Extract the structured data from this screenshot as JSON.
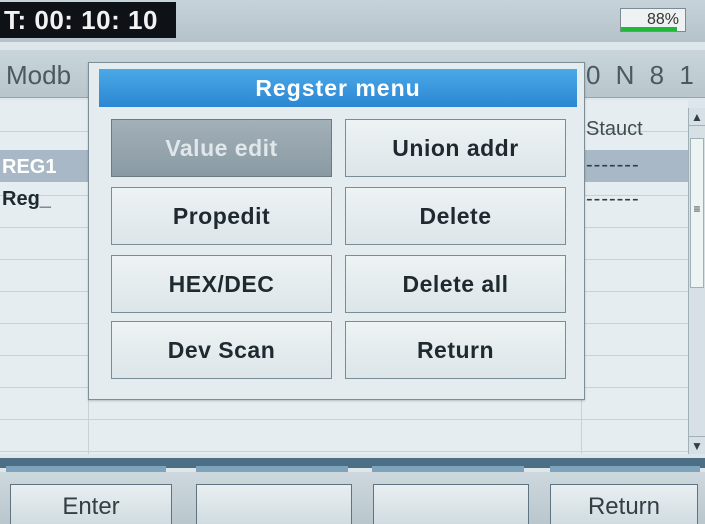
{
  "status": {
    "timer": "T: 00: 10: 10",
    "battery": "88%",
    "battery_level": 0.88
  },
  "header": {
    "title_left": "Modb",
    "title_right": "0 N 8 1"
  },
  "table": {
    "column_header": "Stauct",
    "rows": [
      {
        "label": "REG1",
        "status": "-------"
      },
      {
        "label": "Reg_",
        "status": "-------"
      }
    ]
  },
  "menu": {
    "title": "Regster menu",
    "buttons": {
      "value_edit": "Value edit",
      "union_addr": "Union addr",
      "propedit": "Propedit",
      "delete": "Delete",
      "hex_dec": "HEX/DEC",
      "delete_all": "Delete all",
      "dev_scan": "Dev Scan",
      "return": "Return"
    }
  },
  "softkeys": {
    "enter": "Enter",
    "key2": "",
    "key3": "",
    "return": "Return"
  },
  "colors": {
    "accent": "#2c86d2",
    "status_bar_dark": "#0e1216",
    "battery_green": "#1fb83a"
  }
}
